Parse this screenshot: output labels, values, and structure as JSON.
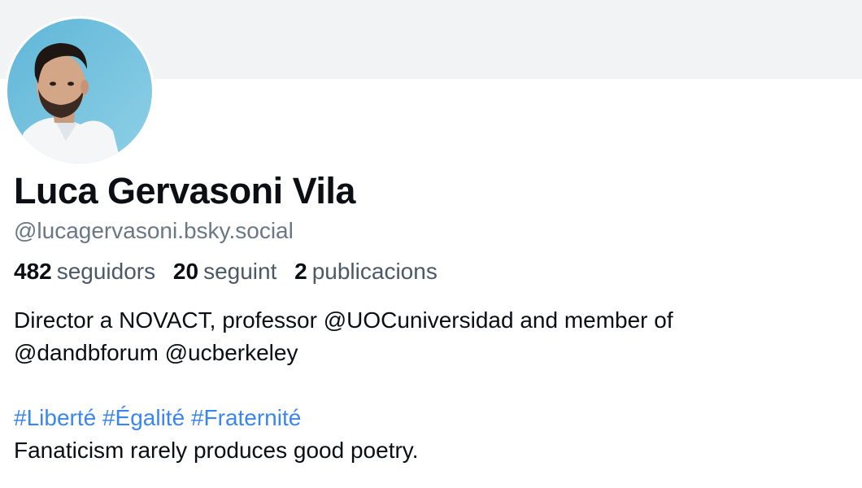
{
  "profile": {
    "display_name": "Luca Gervasoni Vila",
    "handle": "@lucagervasoni.bsky.social",
    "avatar_alt": "profile-avatar"
  },
  "stats": [
    {
      "value": "482",
      "label": "seguidors"
    },
    {
      "value": "20",
      "label": "seguint"
    },
    {
      "value": "2",
      "label": "publicacions"
    }
  ],
  "bio": {
    "line1": "Director a NOVACT, professor @UOCuniversidad and member of",
    "line2": "@dandbforum @ucberkeley",
    "hashtags": [
      "#Liberté",
      "#Égalité",
      "#Fraternité"
    ],
    "line4": "Fanaticism rarely produces good poetry."
  },
  "colors": {
    "banner": "#f1f3f5",
    "link": "#3a86f0",
    "muted": "#6a7785"
  }
}
